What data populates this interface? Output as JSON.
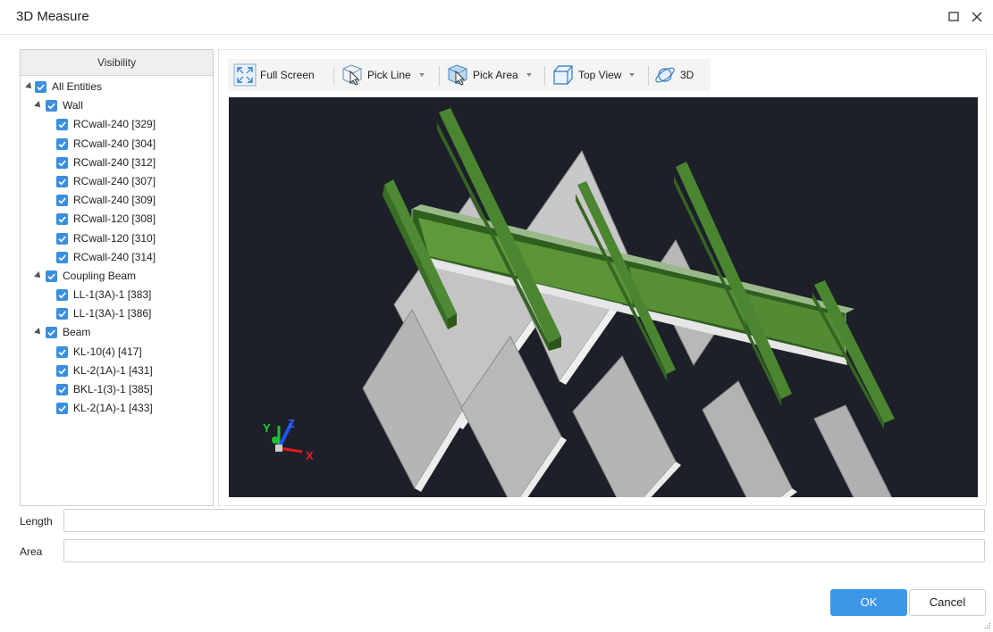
{
  "window": {
    "title": "3D Measure"
  },
  "visibility": {
    "header": "Visibility",
    "tree": [
      {
        "label": "All Entities",
        "level": 0,
        "expanded": true,
        "checked": true
      },
      {
        "label": "Wall",
        "level": 1,
        "expanded": true,
        "checked": true
      },
      {
        "label": "RCwall-240 [329]",
        "level": 2,
        "checked": true
      },
      {
        "label": "RCwall-240 [304]",
        "level": 2,
        "checked": true
      },
      {
        "label": "RCwall-240 [312]",
        "level": 2,
        "checked": true
      },
      {
        "label": "RCwall-240 [307]",
        "level": 2,
        "checked": true
      },
      {
        "label": "RCwall-240 [309]",
        "level": 2,
        "checked": true
      },
      {
        "label": "RCwall-120 [308]",
        "level": 2,
        "checked": true
      },
      {
        "label": "RCwall-120 [310]",
        "level": 2,
        "checked": true
      },
      {
        "label": "RCwall-240 [314]",
        "level": 2,
        "checked": true
      },
      {
        "label": "Coupling Beam",
        "level": 1,
        "expanded": true,
        "checked": true
      },
      {
        "label": "LL-1(3A)-1 [383]",
        "level": 2,
        "checked": true
      },
      {
        "label": "LL-1(3A)-1 [386]",
        "level": 2,
        "checked": true
      },
      {
        "label": "Beam",
        "level": 1,
        "expanded": true,
        "checked": true
      },
      {
        "label": "KL-10(4) [417]",
        "level": 2,
        "checked": true
      },
      {
        "label": "KL-2(1A)-1 [431]",
        "level": 2,
        "checked": true
      },
      {
        "label": "BKL-1(3)-1 [385]",
        "level": 2,
        "checked": true
      },
      {
        "label": "KL-2(1A)-1 [433]",
        "level": 2,
        "checked": true
      }
    ]
  },
  "toolbar": {
    "full_screen": "Full Screen",
    "pick_line": "Pick Line",
    "pick_area": "Pick Area",
    "top_view": "Top View",
    "view_3d": "3D"
  },
  "axes": {
    "x": "X",
    "y": "Y",
    "z": "Z"
  },
  "fields": {
    "length_label": "Length",
    "length_value": "",
    "area_label": "Area",
    "area_value": ""
  },
  "buttons": {
    "ok": "OK",
    "cancel": "Cancel"
  },
  "colors": {
    "accent": "#3d97e8",
    "checkbox": "#3b8fde",
    "scene_background": "#1d2028",
    "wall": "#b5b5b5",
    "beam": "#3f7f2a",
    "coupling_beam": "#4e8a33"
  }
}
